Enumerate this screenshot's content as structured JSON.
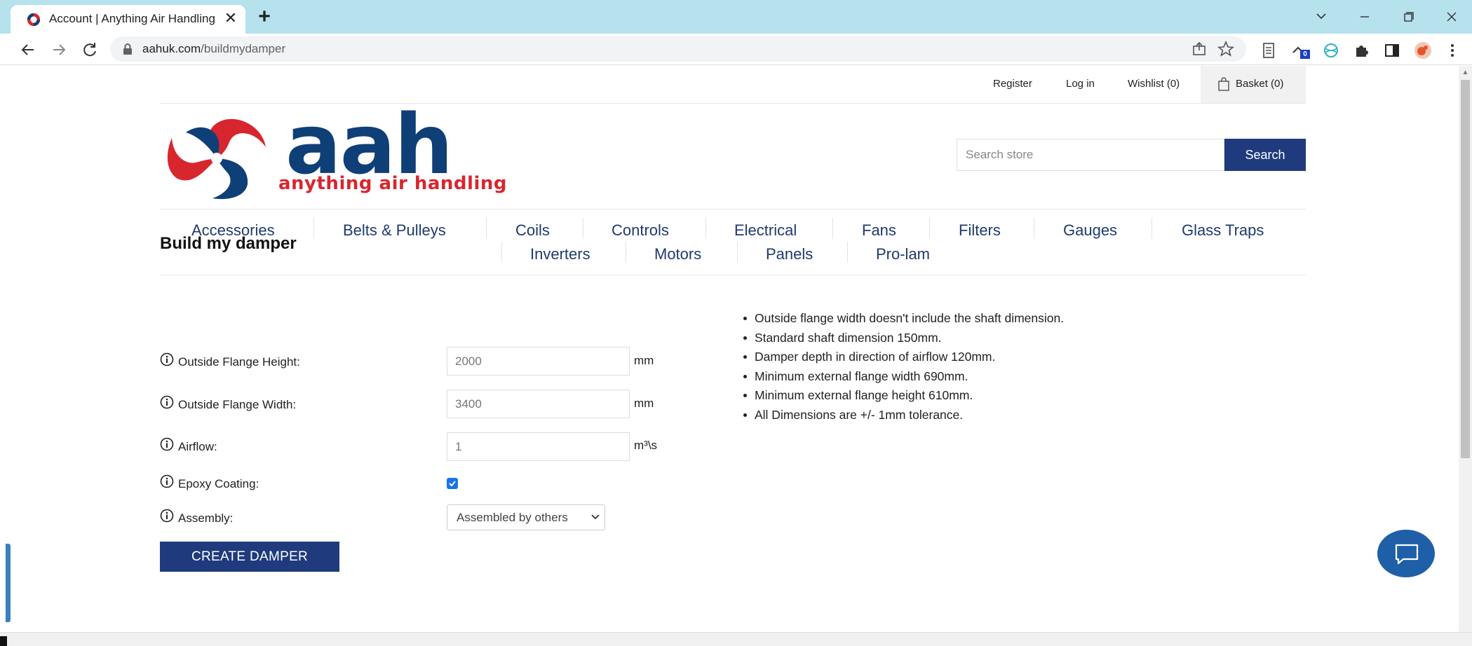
{
  "browser": {
    "tab_title": "Account | Anything Air Handling",
    "tab_close": "✕",
    "new_tab": "+",
    "url_host": "aahuk.com",
    "url_path": "/buildmydamper"
  },
  "header": {
    "register": "Register",
    "login": "Log in",
    "wishlist": "Wishlist (0)",
    "basket": "Basket (0)"
  },
  "logo": {
    "word": "aah",
    "tagline": "anything air handling",
    "colors": {
      "navy": "#0f3f77",
      "red": "#d8262f"
    }
  },
  "search": {
    "placeholder": "Search store",
    "button": "Search"
  },
  "nav": {
    "row1": [
      "Accessories",
      "Belts & Pulleys",
      "Coils",
      "Controls",
      "Electrical",
      "Fans",
      "Filters",
      "Gauges",
      "Glass Traps"
    ],
    "row2": [
      "Inverters",
      "Motors",
      "Panels",
      "Pro-lam"
    ]
  },
  "form": {
    "title": "Build my damper",
    "height_label": "Outside Flange Height:",
    "height_value": "2000",
    "height_unit": "mm",
    "width_label": "Outside Flange Width:",
    "width_value": "3400",
    "width_unit": "mm",
    "airflow_label": "Airflow:",
    "airflow_value": "1",
    "airflow_unit": "m³\\s",
    "epoxy_label": "Epoxy Coating:",
    "epoxy_checked": true,
    "assembly_label": "Assembly:",
    "assembly_value": "Assembled by others",
    "submit": "CREATE DAMPER"
  },
  "notes": [
    "Outside flange width doesn't include the shaft dimension.",
    "Standard shaft dimension 150mm.",
    "Damper depth in direction of airflow 120mm.",
    "Minimum external flange width 690mm.",
    "Minimum external flange height 610mm.",
    "All Dimensions are +/- 1mm tolerance."
  ],
  "extensions": {
    "badge_count": "0"
  },
  "colors": {
    "primary_button": "#1f3a7d",
    "nav_text": "#1f3a6e",
    "chat_button": "#1f5fa8",
    "tabstrip": "#b6e2ee"
  }
}
